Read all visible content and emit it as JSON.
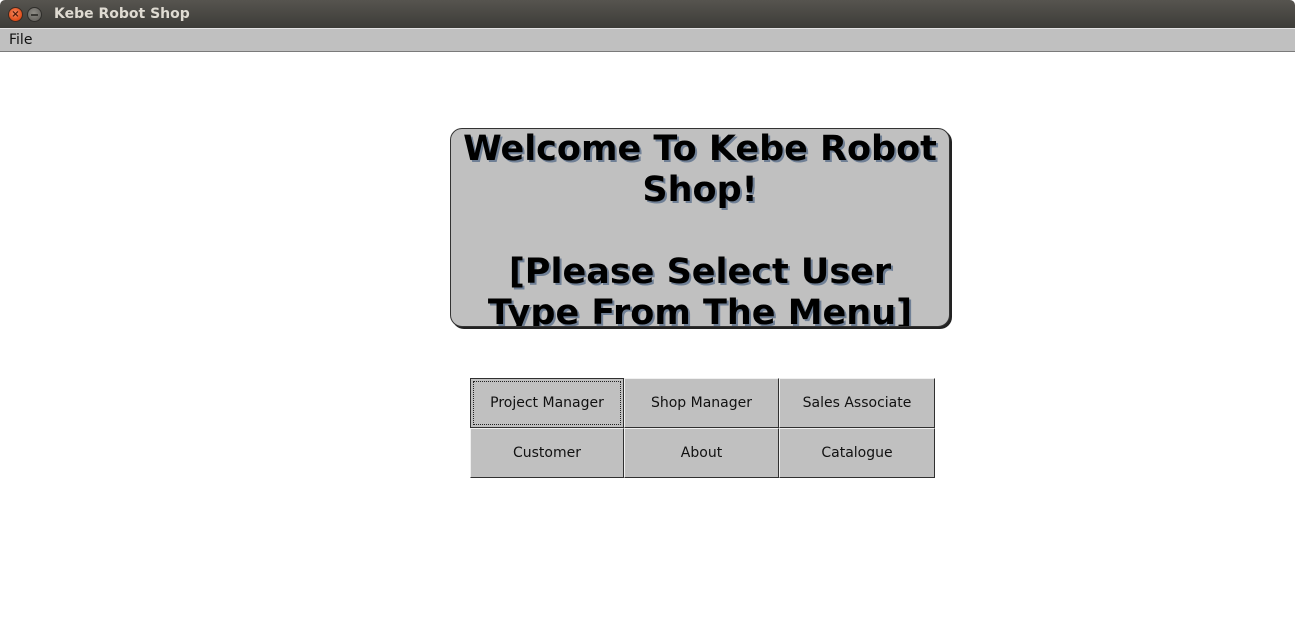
{
  "window": {
    "title": "Kebe Robot Shop"
  },
  "menubar": {
    "items": [
      {
        "label": "File"
      }
    ]
  },
  "welcome": {
    "line1": "Welcome To Kebe Robot",
    "line2": "Shop!",
    "line3": "[Please Select User",
    "line4": "Type From The Menu]"
  },
  "buttons": [
    {
      "label": "Project Manager",
      "focused": true
    },
    {
      "label": "Shop Manager"
    },
    {
      "label": "Sales Associate"
    },
    {
      "label": "Customer"
    },
    {
      "label": "About"
    },
    {
      "label": "Catalogue"
    }
  ],
  "colors": {
    "background": "#ffffff",
    "panel": "#c0c0c0",
    "text_shadow": "#6f7f95"
  }
}
